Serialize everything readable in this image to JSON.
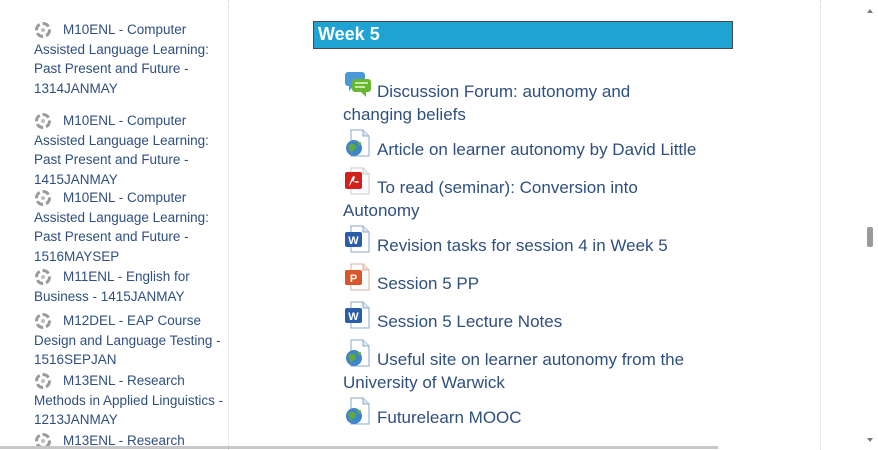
{
  "sidebar": {
    "courses": [
      {
        "icon": "course-icon",
        "label": "M10ENL - Computer Assisted Language Learning: Past Present and Future - 1314JANMAY"
      },
      {
        "icon": "course-icon",
        "label": "M10ENL - Computer Assisted Language Learning: Past Present and Future - 1415JANMAY"
      },
      {
        "icon": "course-icon",
        "label": "M10ENL - Computer Assisted Language Learning: Past Present and Future - 1516MAYSEP"
      },
      {
        "icon": "course-icon",
        "label": "M11ENL - English for Business - 1415JANMAY"
      },
      {
        "icon": "course-icon",
        "label": "M12DEL - EAP Course Design and Language Testing - 1516SEPJAN"
      },
      {
        "icon": "course-icon",
        "label": "M13ENL - Research Methods in Applied Linguistics - 1213JANMAY"
      },
      {
        "icon": "course-icon",
        "label": "M13ENL - Research"
      }
    ]
  },
  "section": {
    "title": "Week 5",
    "activities": [
      {
        "icon": "forum-icon",
        "label": "Discussion Forum: autonomy and changing beliefs"
      },
      {
        "icon": "url-icon",
        "label": "Article on learner autonomy by David Little"
      },
      {
        "icon": "pdf-icon",
        "label": "To read (seminar): Conversion into Autonomy"
      },
      {
        "icon": "word-document-icon",
        "label": "Revision tasks for session 4 in Week 5"
      },
      {
        "icon": "powerpoint-icon",
        "label": "Session 5 PP"
      },
      {
        "icon": "word-document-icon",
        "label": "Session 5 Lecture Notes"
      },
      {
        "icon": "url-icon",
        "label": "Useful site on learner autonomy from the University of Warwick"
      },
      {
        "icon": "url-icon",
        "label": "Futurelearn MOOC"
      }
    ]
  },
  "colors": {
    "link": "#2f4f7f",
    "week_header_bg": "#1fa3d3"
  }
}
